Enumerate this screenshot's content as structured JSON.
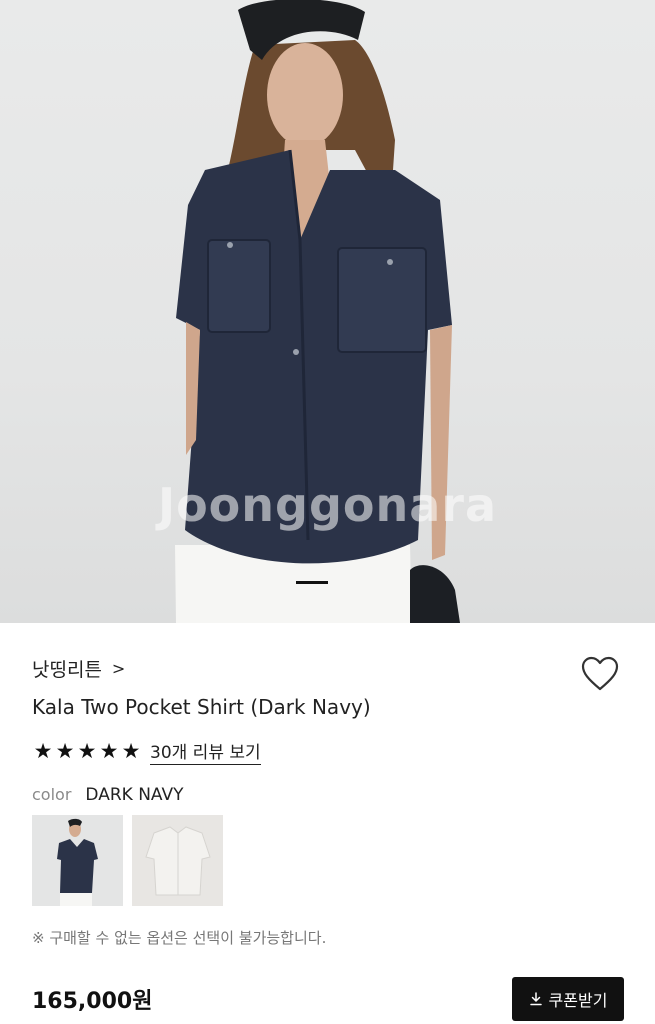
{
  "hero": {
    "watermark": "Joonggonara",
    "slide_indicator": "current-slide"
  },
  "product": {
    "brand": "낫띵리튼",
    "brand_chevron": ">",
    "title": "Kala Two Pocket Shirt (Dark Navy)",
    "rating": 5,
    "review_link": "30개 리뷰 보기",
    "color_label": "color",
    "color_value": "DARK NAVY",
    "swatches": [
      {
        "name": "dark-navy",
        "selected": true
      },
      {
        "name": "white",
        "selected": false
      }
    ],
    "notice": "※ 구매할 수 없는 옵션은 선택이 불가능합니다.",
    "price": "165,000원"
  },
  "actions": {
    "coupon_label": "쿠폰받기",
    "wish_icon": "heart-outline-icon",
    "coupon_icon": "download-icon"
  },
  "colors": {
    "navy": "#2b3348",
    "background": "#e6e7e7",
    "button": "#111111"
  }
}
